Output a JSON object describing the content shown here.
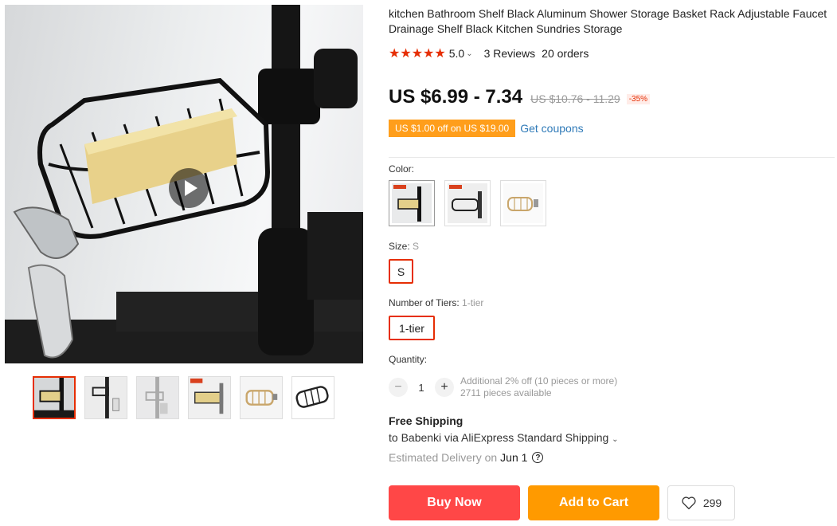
{
  "gallery": {
    "thumb_count": 6,
    "active_index": 0
  },
  "product": {
    "title": "kitchen Bathroom Shelf Black Aluminum Shower Storage Basket Rack Adjustable Faucet Drainage Shelf Black Kitchen Sundries Storage",
    "stars": "★★★★★",
    "rating": "5.0",
    "rating_chevron": "⌄",
    "reviews": "3 Reviews",
    "orders": "20 orders"
  },
  "price": {
    "current": "US $6.99 - 7.34",
    "original": "US $10.76 - 11.29",
    "discount": "-35%"
  },
  "coupon": {
    "badge": "US $1.00 off on US $19.00",
    "link": "Get coupons"
  },
  "options": {
    "color_label": "Color:",
    "size_label": "Size:",
    "size_selected": "S",
    "size_value": "S",
    "tier_label": "Number of Tiers:",
    "tier_selected": "1-tier",
    "tier_value": "1-tier"
  },
  "quantity": {
    "label": "Quantity:",
    "minus": "−",
    "value": "1",
    "plus": "+",
    "note_line1": "Additional 2% off (10 pieces or more)",
    "note_line2": "2711 pieces available"
  },
  "shipping": {
    "title": "Free Shipping",
    "to": "to Babenki via AliExpress Standard Shipping",
    "to_chevron": "⌄",
    "estimated": "Estimated Delivery on",
    "date": "Jun 1",
    "help": "?"
  },
  "actions": {
    "buy_now": "Buy Now",
    "add_to_cart": "Add to Cart",
    "wishlist_count": "299"
  },
  "colors": {
    "accent_red": "#e62e04",
    "buy_red": "#ff4747",
    "cart_orange": "#ff9a00",
    "coupon_orange": "#ff9e1b",
    "link_blue": "#2f7ab8"
  }
}
